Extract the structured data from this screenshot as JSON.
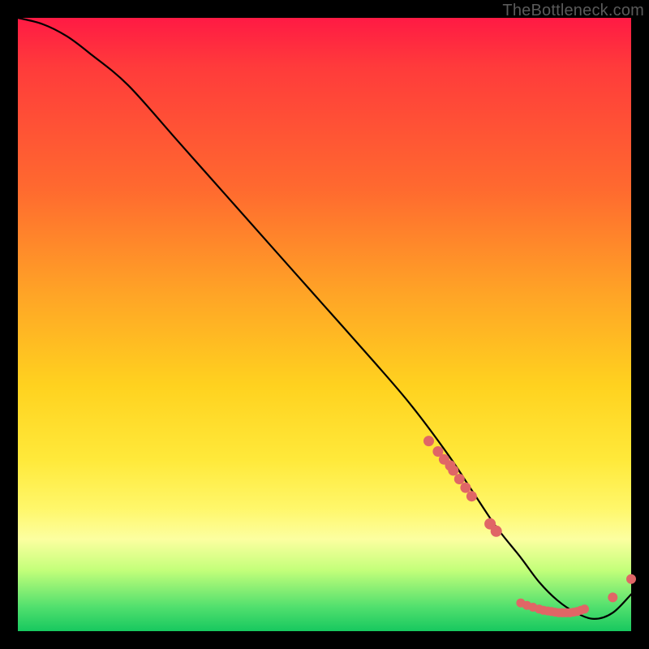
{
  "watermark": "TheBottleneck.com",
  "chart_data": {
    "type": "line",
    "title": "",
    "xlabel": "",
    "ylabel": "",
    "xlim": [
      0,
      100
    ],
    "ylim": [
      0,
      100
    ],
    "grid": false,
    "legend": false,
    "curve": {
      "name": "curve",
      "color": "#000000",
      "x": [
        0,
        4,
        8,
        12,
        18,
        26,
        34,
        42,
        50,
        58,
        64,
        70,
        74,
        78,
        82,
        85,
        88,
        91,
        94,
        97,
        100
      ],
      "y": [
        100,
        99,
        97,
        94,
        89,
        80,
        71,
        62,
        53,
        44,
        37,
        29,
        23,
        17,
        12,
        8,
        5,
        3,
        2,
        3,
        6
      ]
    },
    "upper_markers": {
      "name": "upper-cluster",
      "color": "#e06666",
      "x": [
        67,
        68.5,
        69.5,
        70.5,
        71,
        72,
        73,
        74
      ],
      "y": [
        31,
        29.3,
        28,
        27,
        26.2,
        24.8,
        23.4,
        22
      ]
    },
    "mid_markers": {
      "name": "mid-pair",
      "color": "#e06666",
      "x": [
        77,
        78
      ],
      "y": [
        17.5,
        16.3
      ]
    },
    "bottom_markers": {
      "name": "bottom-cluster",
      "color": "#e06666",
      "x": [
        82,
        83,
        84,
        85,
        85.7,
        86.4,
        87,
        87.6,
        88.2,
        88.8,
        89.4,
        90,
        90.6,
        91.2,
        91.8,
        92.4
      ],
      "y": [
        4.6,
        4.2,
        3.9,
        3.6,
        3.4,
        3.3,
        3.2,
        3.1,
        3.0,
        3.0,
        3.0,
        3.0,
        3.1,
        3.2,
        3.4,
        3.6
      ]
    },
    "tail_markers": {
      "name": "tail-pair",
      "color": "#e06666",
      "x": [
        97,
        100
      ],
      "y": [
        5.5,
        8.5
      ]
    }
  }
}
